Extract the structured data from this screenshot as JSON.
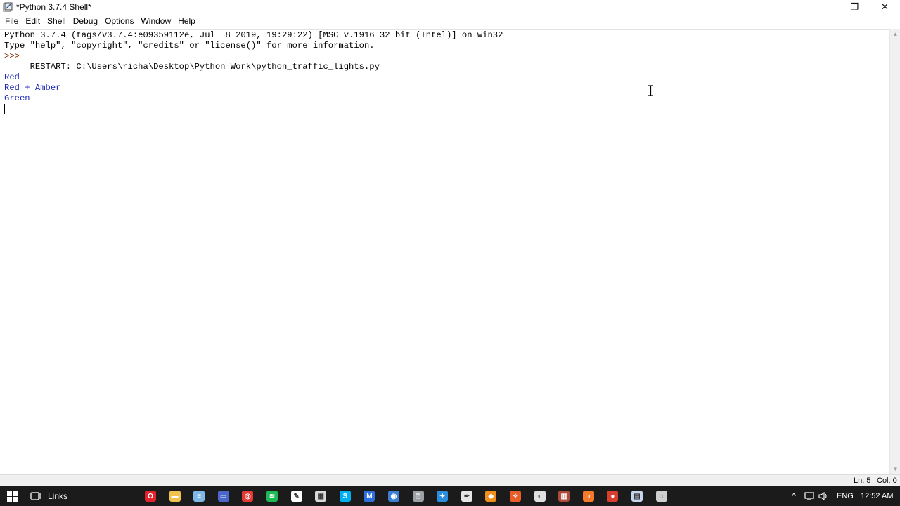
{
  "window": {
    "title": "*Python 3.7.4 Shell*",
    "controls": {
      "minimize": "—",
      "restore": "❐",
      "close": "✕"
    }
  },
  "menu": [
    "File",
    "Edit",
    "Shell",
    "Debug",
    "Options",
    "Window",
    "Help"
  ],
  "shell": {
    "lines": [
      {
        "text": "Python 3.7.4 (tags/v3.7.4:e09359112e, Jul  8 2019, 19:29:22) [MSC v.1916 32 bit (Intel)] on win32",
        "kind": "normal"
      },
      {
        "text": "Type \"help\", \"copyright\", \"credits\" or \"license()\" for more information.",
        "kind": "normal"
      },
      {
        "text": ">>> ",
        "kind": "prompt"
      },
      {
        "text": "==== RESTART: C:\\Users\\richa\\Desktop\\Python Work\\python_traffic_lights.py ====",
        "kind": "normal"
      },
      {
        "text": "Red",
        "kind": "stdout"
      },
      {
        "text": "Red + Amber",
        "kind": "stdout"
      },
      {
        "text": "Green",
        "kind": "stdout"
      }
    ]
  },
  "status": {
    "line": "Ln: 5",
    "col": "Col: 0"
  },
  "taskbar": {
    "start_icon": "windows-logo-icon",
    "task_view_icon": "task-view-icon",
    "links_label": "Links",
    "apps": [
      {
        "name": "opera-icon",
        "color": "#e3232b",
        "glyph": "O"
      },
      {
        "name": "file-explorer-icon",
        "color": "#f2c14e",
        "glyph": "▬"
      },
      {
        "name": "notepad-icon",
        "color": "#7fb7e6",
        "glyph": "≡"
      },
      {
        "name": "screen-app-icon",
        "color": "#4a67c9",
        "glyph": "▭"
      },
      {
        "name": "red-app-icon",
        "color": "#e53935",
        "glyph": "◎"
      },
      {
        "name": "spotify-icon",
        "color": "#1db954",
        "glyph": "≋"
      },
      {
        "name": "idle-icon",
        "color": "#ffffff",
        "glyph": "✎"
      },
      {
        "name": "calculator-icon",
        "color": "#d9d9d9",
        "glyph": "▦"
      },
      {
        "name": "skype-icon",
        "color": "#00aff0",
        "glyph": "S"
      },
      {
        "name": "mail-icon",
        "color": "#2f6fde",
        "glyph": "M"
      },
      {
        "name": "steam-icon",
        "color": "#3b7fd6",
        "glyph": "◉"
      },
      {
        "name": "app-icon-a",
        "color": "#9aa0a6",
        "glyph": "⊡"
      },
      {
        "name": "app-icon-b",
        "color": "#2a8de0",
        "glyph": "✦"
      },
      {
        "name": "pen-icon",
        "color": "#e6e6e6",
        "glyph": "✒"
      },
      {
        "name": "flame-app-icon",
        "color": "#f18f1d",
        "glyph": "◆"
      },
      {
        "name": "app-icon-c",
        "color": "#e85d2a",
        "glyph": "✧"
      },
      {
        "name": "obs-icon",
        "color": "#e0e0e0",
        "glyph": "◐"
      },
      {
        "name": "archive-icon",
        "color": "#b04a3b",
        "glyph": "▥"
      },
      {
        "name": "blender-icon",
        "color": "#f5792a",
        "glyph": "◑"
      },
      {
        "name": "app-icon-d",
        "color": "#d93f2f",
        "glyph": "●"
      },
      {
        "name": "document-icon",
        "color": "#c7d6ee",
        "glyph": "▤"
      },
      {
        "name": "settings-app-icon",
        "color": "#cfcfcf",
        "glyph": "◌"
      }
    ],
    "tray": {
      "chevron": "^",
      "language": "ENG",
      "time": "12:52 AM"
    }
  }
}
